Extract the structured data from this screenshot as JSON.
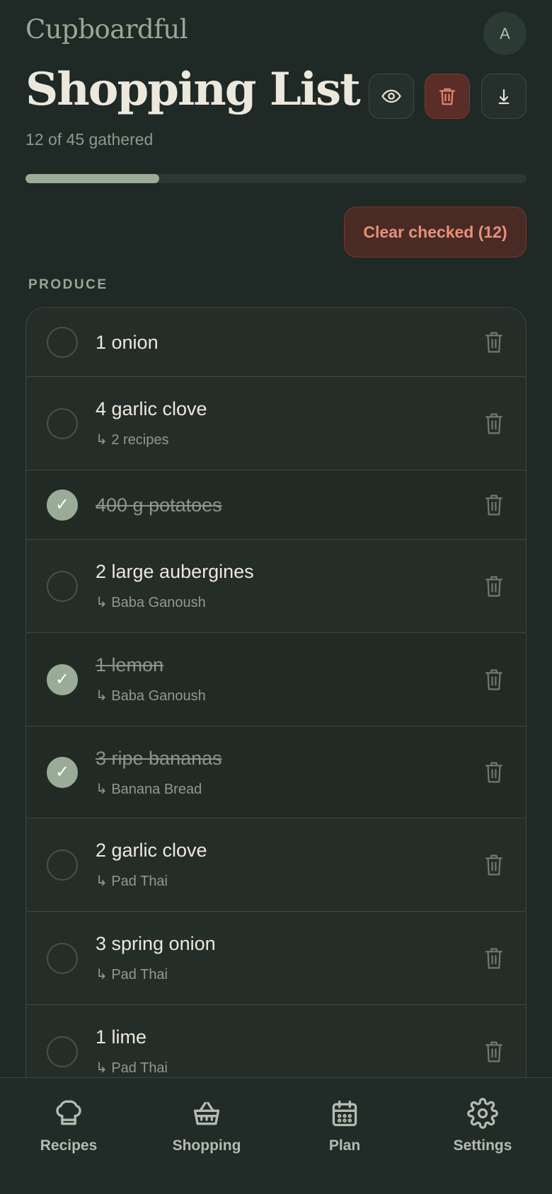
{
  "brand": "Cupboardful",
  "avatar_initial": "A",
  "page_title": "Shopping List",
  "progress": {
    "text": "12 of 45 gathered",
    "fraction": 0.2667
  },
  "toolbar": {
    "view_icon": "eye-icon",
    "delete_icon": "trash-icon",
    "download_icon": "download-icon"
  },
  "clear_button": "Clear checked (12)",
  "section": "PRODUCE",
  "items": [
    {
      "name": "1 onion",
      "sub": "",
      "checked": false
    },
    {
      "name": "4 garlic clove",
      "sub": "↳ 2 recipes",
      "checked": false
    },
    {
      "name": "400 g potatoes",
      "sub": "",
      "checked": true
    },
    {
      "name": "2 large aubergines",
      "sub": "↳ Baba Ganoush",
      "checked": false
    },
    {
      "name": "1 lemon",
      "sub": "↳ Baba Ganoush",
      "checked": true
    },
    {
      "name": "3 ripe bananas",
      "sub": "↳ Banana Bread",
      "checked": true
    },
    {
      "name": "2 garlic clove",
      "sub": "↳ Pad Thai",
      "checked": false
    },
    {
      "name": "3 spring onion",
      "sub": "↳ Pad Thai",
      "checked": false
    },
    {
      "name": "1 lime",
      "sub": "↳ Pad Thai",
      "checked": false
    }
  ],
  "nav": [
    {
      "label": "Recipes",
      "icon": "chef-hat-icon"
    },
    {
      "label": "Shopping",
      "icon": "basket-icon"
    },
    {
      "label": "Plan",
      "icon": "calendar-icon"
    },
    {
      "label": "Settings",
      "icon": "gear-icon"
    }
  ],
  "colors": {
    "background": "#1f2925",
    "accent": "#9aab97",
    "danger": "#e8907a"
  }
}
